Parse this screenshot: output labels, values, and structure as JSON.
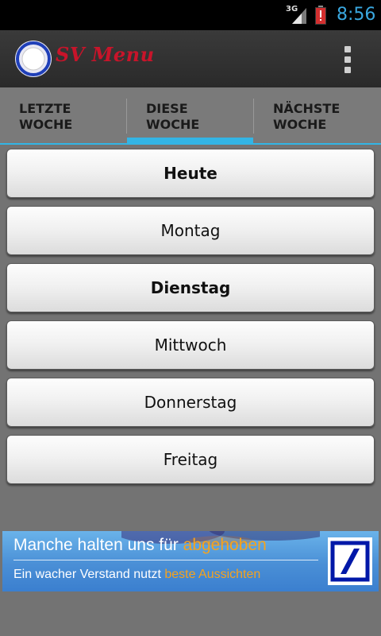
{
  "status_bar": {
    "network": "3G",
    "time": "8:56",
    "colors": {
      "clock": "#3aa8e0",
      "battery_alert": "#d32f2f"
    }
  },
  "action_bar": {
    "title": "SV Menu",
    "logo_icon": "circle-logo-icon",
    "menu_icon": "overflow-menu-icon",
    "colors": {
      "title": "#c8142a",
      "logo_ring": "#1f3fb8"
    }
  },
  "tabs": [
    {
      "line1": "LETZTE",
      "line2": "WOCHE",
      "selected": false
    },
    {
      "line1": "DIESE",
      "line2": "WOCHE",
      "selected": true
    },
    {
      "line1": "NÄCHSTE",
      "line2": "WOCHE",
      "selected": false
    }
  ],
  "tab_indicator_color": "#33b5e5",
  "days": [
    {
      "label": "Heute",
      "bold": true
    },
    {
      "label": "Montag",
      "bold": false
    },
    {
      "label": "Dienstag",
      "bold": true
    },
    {
      "label": "Mittwoch",
      "bold": false
    },
    {
      "label": "Donnerstag",
      "bold": false
    },
    {
      "label": "Freitag",
      "bold": false
    }
  ],
  "ad": {
    "line1_part1": "Manche halten uns für ",
    "line1_highlight": "abgehoben",
    "line2_part1": "Ein wacher Verstand nutzt ",
    "line2_highlight": "beste Aussichten",
    "logo_icon": "bank-slash-logo-icon",
    "colors": {
      "highlight": "#f6a31c",
      "background": "#4a8fd6",
      "logo": "#0018a8"
    }
  }
}
